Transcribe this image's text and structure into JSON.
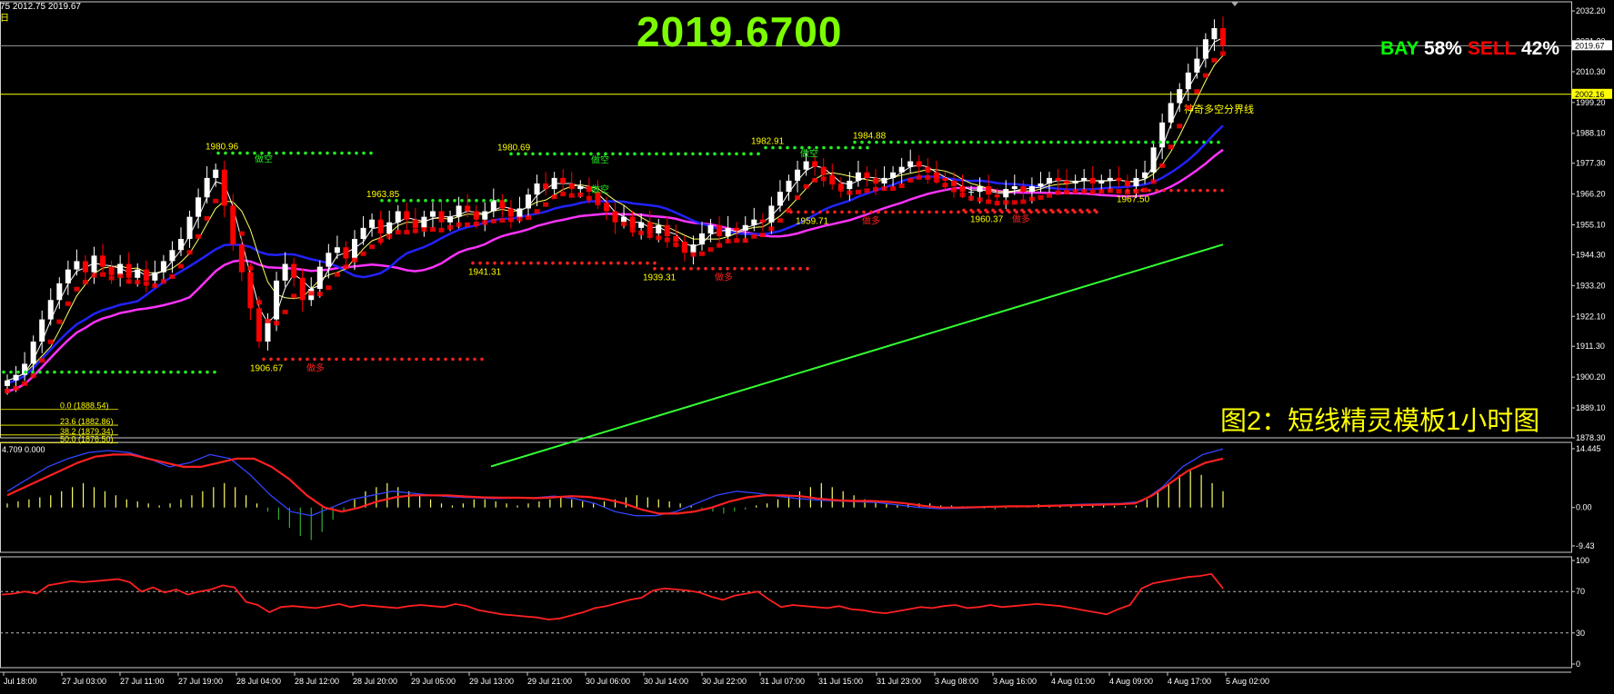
{
  "header": {
    "ohlc_text": "75 2012.75 2019.67",
    "period_glyph": "日",
    "big_price": "2019.6700",
    "bay_label": "BAY",
    "bay_pct": "58%",
    "sell_label": "SELL",
    "sell_pct": "42%",
    "caption": "图2：短线精灵模板1小时图"
  },
  "colors": {
    "background": "#000000",
    "bull_candle": "#ffffff",
    "bear_candle": "#ff0000",
    "ma_fast": "#ffffff",
    "ma_yellow": "#ffff66",
    "ma_blue": "#2222ff",
    "ma_magenta": "#ff33ff",
    "ma_long": "#33ff33",
    "support_dots": "#ff2020",
    "resist_dots": "#22ee22",
    "macd_signal": "#ff2020",
    "macd_main": "#3344ff",
    "rsi_line": "#ff2020"
  },
  "chart_data": [
    {
      "type": "line",
      "panel": "price",
      "ylim": [
        1878.3,
        2035.5
      ],
      "y_ticks": [
        "2032.20",
        "2021.30",
        "2010.30",
        "1999.20",
        "1988.10",
        "1977.30",
        "1966.20",
        "1955.10",
        "1944.30",
        "1933.20",
        "1922.10",
        "1911.30",
        "1900.20",
        "1889.10",
        "1878.30"
      ],
      "current_price_label": "2019.67",
      "horizontal_line_label": "2002.16",
      "horizontal_line_value": 2002.16,
      "horizontal_line_name": "神奇多空分界线",
      "current_price_value": 2019.67,
      "x_labels": [
        "Jul 18:00",
        "27 Jul 03:00",
        "27 Jul 11:00",
        "27 Jul 19:00",
        "28 Jul 04:00",
        "28 Jul 12:00",
        "28 Jul 20:00",
        "29 Jul 05:00",
        "29 Jul 13:00",
        "29 Jul 21:00",
        "30 Jul 06:00",
        "30 Jul 14:00",
        "30 Jul 22:00",
        "31 Jul 07:00",
        "31 Jul 15:00",
        "31 Jul 23:00",
        "3 Aug 08:00",
        "3 Aug 16:00",
        "4 Aug 01:00",
        "4 Aug 09:00",
        "4 Aug 17:00",
        "5 Aug 02:00"
      ],
      "price_path": [
        1899,
        1901,
        1905,
        1913,
        1921,
        1928,
        1934,
        1939,
        1942,
        1938,
        1944,
        1940,
        1937,
        1941,
        1936,
        1939,
        1935,
        1938,
        1942,
        1946,
        1950,
        1958,
        1965,
        1972,
        1975,
        1962,
        1948,
        1938,
        1925,
        1913,
        1921,
        1935,
        1941,
        1936,
        1928,
        1932,
        1940,
        1945,
        1947,
        1943,
        1950,
        1954,
        1957,
        1952,
        1956,
        1960,
        1957,
        1954,
        1958,
        1960,
        1956,
        1958,
        1962,
        1960,
        1957,
        1960,
        1964,
        1961,
        1958,
        1961,
        1966,
        1970,
        1968,
        1972,
        1970,
        1968,
        1969,
        1967,
        1963,
        1960,
        1956,
        1958,
        1954,
        1956,
        1952,
        1955,
        1951,
        1949,
        1945,
        1948,
        1952,
        1955,
        1951,
        1954,
        1953,
        1955,
        1957,
        1956,
        1962,
        1967,
        1971,
        1975,
        1978,
        1976,
        1973,
        1970,
        1968,
        1971,
        1974,
        1972,
        1970,
        1972,
        1974,
        1976,
        1978,
        1976,
        1974,
        1972,
        1971,
        1969,
        1967,
        1967,
        1969,
        1966,
        1965,
        1968,
        1969,
        1967,
        1969,
        1970,
        1972,
        1971,
        1970,
        1971,
        1972,
        1970,
        1971,
        1972,
        1971,
        1969,
        1972,
        1974,
        1983,
        1992,
        1999,
        2004,
        2010,
        2015,
        2022,
        2026,
        2019.67
      ],
      "levels": [
        {
          "label": "1980.96",
          "value": 1980.96,
          "kind": "high",
          "tag": "做空"
        },
        {
          "label": "1963.85",
          "value": 1963.85,
          "kind": "high",
          "tag": ""
        },
        {
          "label": "1980.69",
          "value": 1980.69,
          "kind": "high",
          "tag": "做空"
        },
        {
          "label": "1982.91",
          "value": 1982.91,
          "kind": "high",
          "tag": "做空"
        },
        {
          "label": "1984.88",
          "value": 1984.88,
          "kind": "high",
          "tag": ""
        },
        {
          "label": "1906.67",
          "value": 1906.67,
          "kind": "low",
          "tag": "做多"
        },
        {
          "label": "1941.31",
          "value": 1941.31,
          "kind": "low",
          "tag": "做多"
        },
        {
          "label": "1939.31",
          "value": 1939.31,
          "kind": "low",
          "tag": "做多"
        },
        {
          "label": "1959.71",
          "value": 1959.71,
          "kind": "low",
          "tag": "做多"
        },
        {
          "label": "1960.37",
          "value": 1960.37,
          "kind": "low",
          "tag": "做多"
        },
        {
          "label": "1967.50",
          "value": 1967.5,
          "kind": "low",
          "tag": "做多"
        }
      ],
      "fib_levels": [
        {
          "label": "0.0  (1888.54)",
          "value": 1888.54
        },
        {
          "label": "23.6  (1882.86)",
          "value": 1882.86
        },
        {
          "label": "38.2  (1879.34)",
          "value": 1879.34
        },
        {
          "label": "50.0  (1876.50)",
          "value": 1876.5
        }
      ],
      "long_ma_range": [
        1868,
        1948
      ],
      "signal_text_extra": "做空"
    },
    {
      "type": "line",
      "panel": "macd",
      "legend": "4.709  0.000",
      "ylim": [
        -11,
        16
      ],
      "y_ticks": [
        "14.445",
        "0.00",
        "-9.43"
      ],
      "histogram": [
        1,
        1.5,
        2,
        2.5,
        3,
        4,
        5,
        6,
        5,
        4,
        3,
        2,
        1.5,
        1,
        0.5,
        1,
        2,
        3,
        4,
        5,
        6,
        5,
        3,
        1,
        -1,
        -3,
        -5,
        -7,
        -8,
        -6,
        -3,
        -1,
        2,
        4,
        5,
        6,
        5,
        4,
        3,
        2,
        1,
        0.5,
        1,
        2,
        2,
        1.5,
        1,
        0.5,
        1,
        1.5,
        2,
        2.5,
        2,
        1.5,
        1,
        1.5,
        2,
        2.5,
        3,
        2.5,
        2,
        1.5,
        1,
        0.5,
        -0.5,
        -1,
        -1.5,
        -1,
        -0.5,
        0.5,
        1,
        2,
        3,
        4,
        5,
        6,
        5,
        4,
        3,
        2,
        1.5,
        1,
        0.5,
        1,
        1,
        1,
        0.5,
        0.5,
        0.3,
        0.2,
        -0.3,
        -0.5,
        -0.3,
        0.3,
        0.5,
        0.8,
        0.6,
        0.5,
        0.4,
        0.5,
        0.6,
        0.5,
        0.4,
        0.3,
        0.5,
        2,
        4,
        6,
        8,
        9,
        8,
        6,
        4
      ],
      "signal_line": [
        3,
        5,
        7,
        9,
        11,
        12.5,
        13,
        13,
        12,
        11,
        10,
        10,
        11,
        12,
        12,
        10,
        7,
        3,
        0,
        -1,
        0,
        1.5,
        2.5,
        3,
        3,
        3,
        2.7,
        2.5,
        2.4,
        2.4,
        2.3,
        2.5,
        2.8,
        2.6,
        2,
        1,
        -0.5,
        -1.5,
        -1.5,
        -1,
        0,
        1.5,
        2.5,
        3,
        3,
        2.8,
        2.2,
        1.8,
        1.6,
        1.6,
        1.4,
        1,
        0.4,
        0,
        0,
        0.1,
        0.2,
        0.3,
        0.3,
        0.4,
        0.5,
        0.6,
        0.7,
        0.8,
        1,
        3,
        6,
        9,
        11,
        12
      ],
      "main_line": [
        4,
        7,
        10,
        12,
        13.5,
        14,
        13.5,
        12,
        10,
        11,
        13,
        12,
        8,
        3,
        -1,
        -2,
        0,
        2,
        3,
        4,
        3.5,
        3,
        2.6,
        2.4,
        2.2,
        2.3,
        2.4,
        2.8,
        2.2,
        1,
        -1,
        -2,
        -2,
        -1,
        1,
        3,
        4,
        3.5,
        2.8,
        2.2,
        1.8,
        1.6,
        1.4,
        1.2,
        0.6,
        0,
        -0.3,
        -0.2,
        0,
        0.2,
        0.3,
        0.4,
        0.6,
        0.8,
        0.9,
        1,
        1.5,
        5,
        10,
        13,
        14.4
      ]
    },
    {
      "type": "line",
      "panel": "oscillator",
      "ylim": [
        0,
        100
      ],
      "y_ticks": [
        "100",
        "70",
        "30",
        "0"
      ],
      "dashed_levels": [
        70,
        30
      ],
      "values": [
        67,
        68,
        70,
        68,
        76,
        78,
        80,
        79,
        80,
        81,
        82,
        79,
        70,
        74,
        69,
        72,
        67,
        70,
        72,
        76,
        74,
        60,
        57,
        50,
        55,
        56,
        55,
        54,
        56,
        58,
        55,
        57,
        56,
        55,
        54,
        56,
        57,
        56,
        55,
        58,
        56,
        52,
        50,
        48,
        47,
        46,
        45,
        43,
        44,
        47,
        50,
        54,
        56,
        59,
        62,
        64,
        71,
        73,
        72,
        71,
        69,
        65,
        62,
        66,
        68,
        70,
        62,
        55,
        57,
        56,
        55,
        54,
        56,
        53,
        52,
        50,
        49,
        51,
        53,
        55,
        54,
        56,
        57,
        54,
        55,
        57,
        55,
        56,
        57,
        58,
        57,
        56,
        54,
        52,
        50,
        48,
        53,
        57,
        73,
        78,
        80,
        82,
        84,
        85,
        87,
        73
      ]
    }
  ]
}
